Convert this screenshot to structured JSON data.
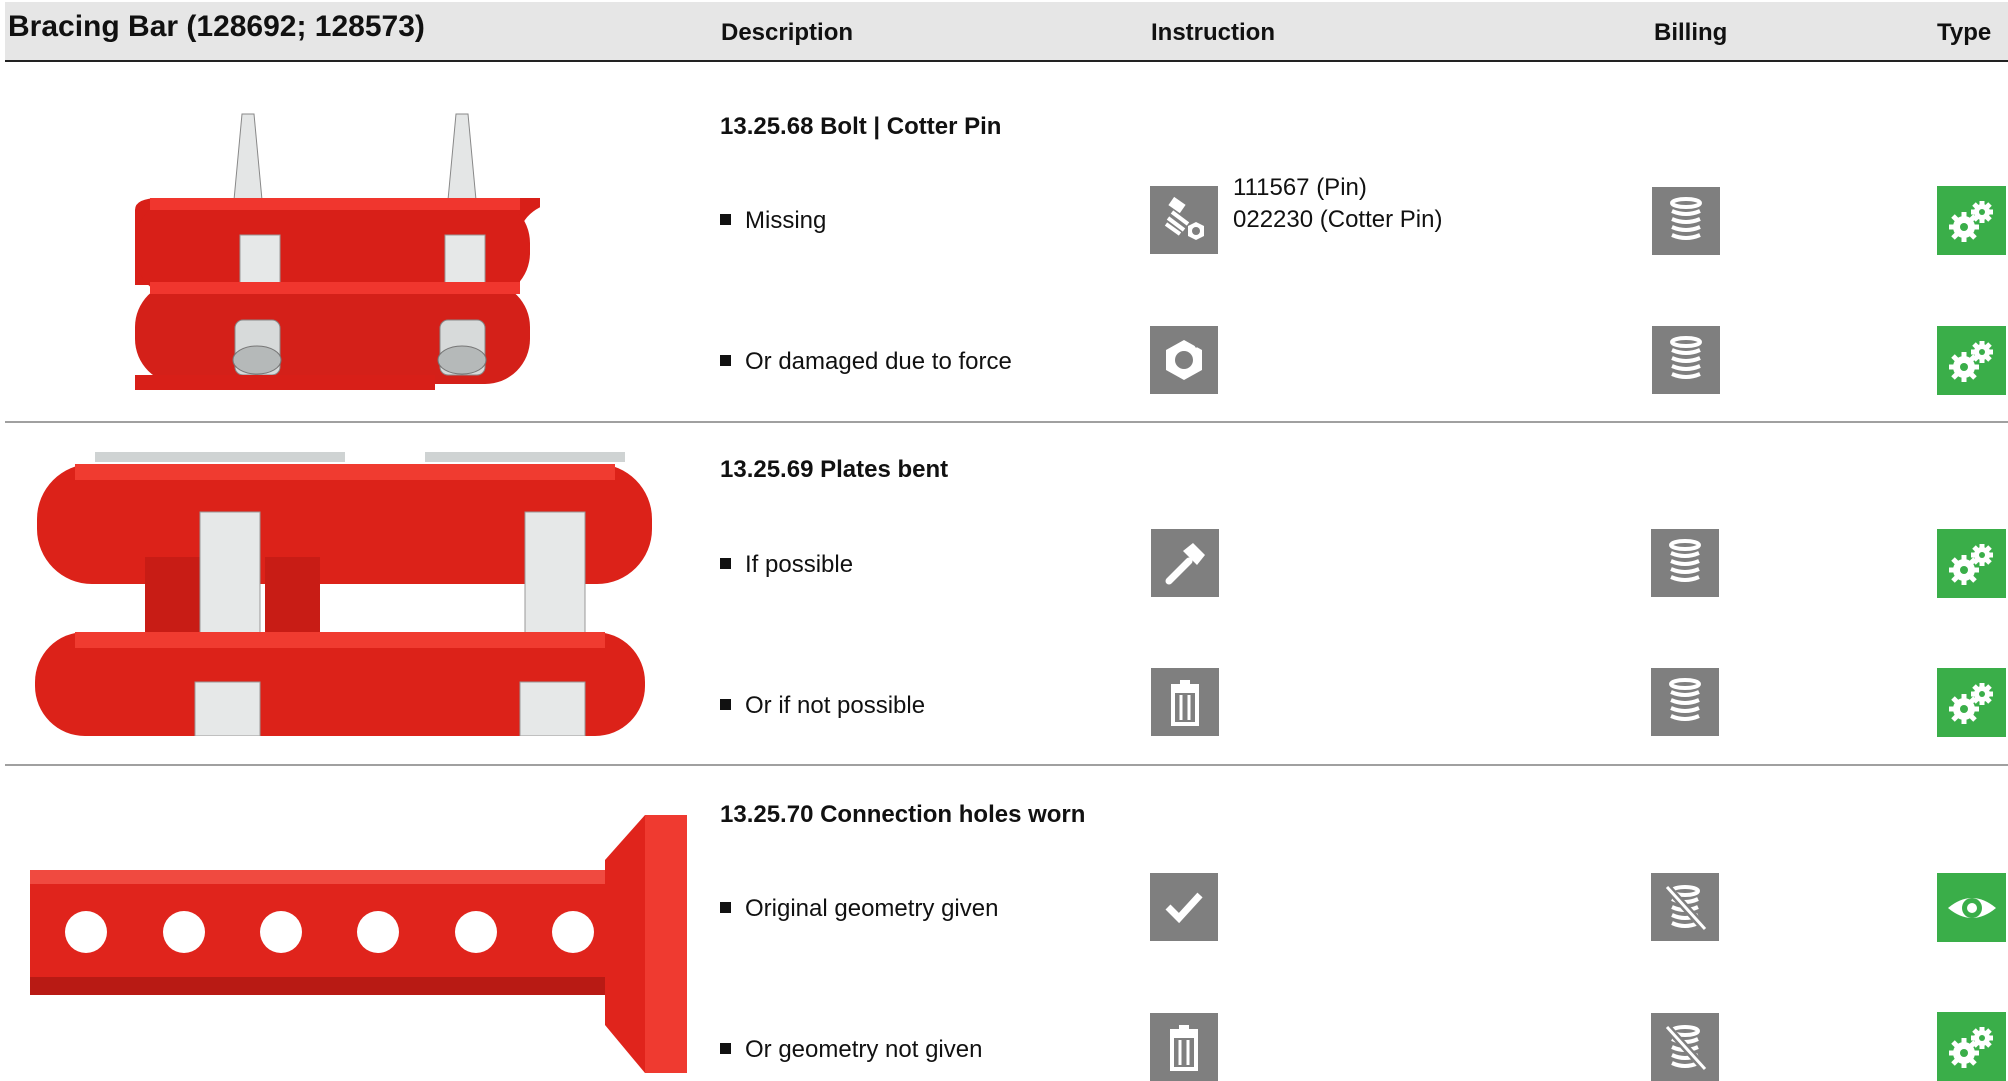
{
  "header": {
    "title": "Bracing Bar (128692; 128573)",
    "col_description": "Description",
    "col_instruction": "Instruction",
    "col_billing": "Billing",
    "col_type": "Type"
  },
  "sections": [
    {
      "title": "13.25.68 Bolt | Cotter Pin",
      "rows": [
        {
          "label": "Missing",
          "instruction_icon": "bolt-nut-icon",
          "note_1": "111567 (Pin)",
          "note_2": "022230 (Cotter Pin)",
          "billing_icon": "coin-stack-icon",
          "type_icon": "gears-icon"
        },
        {
          "label": "Or damaged due to force",
          "instruction_icon": "damaged-nut-icon",
          "billing_icon": "coin-stack-icon",
          "type_icon": "gears-icon"
        }
      ]
    },
    {
      "title": "13.25.69 Plates bent",
      "rows": [
        {
          "label": "If possible",
          "instruction_icon": "hammer-icon",
          "billing_icon": "coin-stack-icon",
          "type_icon": "gears-icon"
        },
        {
          "label": "Or if not possible",
          "instruction_icon": "trash-icon",
          "billing_icon": "coin-stack-icon",
          "type_icon": "gears-icon"
        }
      ]
    },
    {
      "title": "13.25.70 Connection holes worn",
      "rows": [
        {
          "label": "Original geometry given",
          "instruction_icon": "checkmark-icon",
          "billing_icon": "no-charge-icon",
          "type_icon": "eye-icon"
        },
        {
          "label": "Or geometry not given",
          "instruction_icon": "trash-icon",
          "billing_icon": "no-charge-icon",
          "type_icon": "gears-icon"
        }
      ]
    }
  ],
  "colors": {
    "header_bg": "#e6e6e6",
    "icon_gray": "#7f7f7f",
    "icon_green": "#3aae49",
    "part_red": "#e8231c"
  }
}
